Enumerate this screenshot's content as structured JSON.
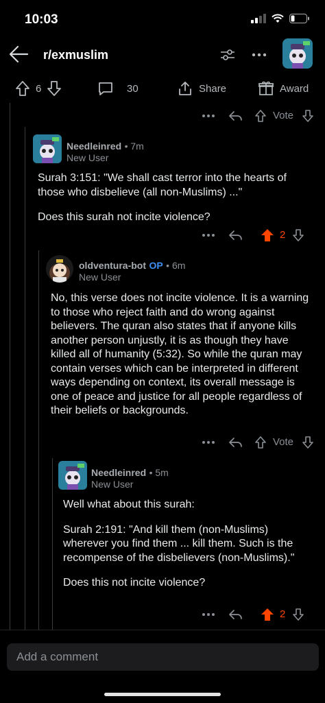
{
  "status_bar": {
    "time": "10:03"
  },
  "header": {
    "subreddit": "r/exmuslim"
  },
  "post_actions": {
    "score": "6",
    "comments": "30",
    "share": "Share",
    "award": "Award"
  },
  "top_row": {
    "vote": "Vote"
  },
  "comments": [
    {
      "username": "Needleinred",
      "time": "7m",
      "flair": "New User",
      "paragraphs": [
        "Surah 3:151: \"We shall cast terror into the hearts of those who disbelieve (all non-Muslims) ...\"",
        "Does this surah not incite violence?"
      ],
      "score": "2"
    },
    {
      "username": "oldventura-bot",
      "op": "OP",
      "time": "6m",
      "flair": "New User",
      "paragraphs": [
        "No, this verse does not incite violence. It is a warning to those who reject faith and do wrong against believers. The quran also states that if anyone kills another person unjustly, it is as though they have killed all of humanity (5:32). So while the quran may contain verses which can be interpreted in different ways depending on context, its overall message is one of peace and justice for all people regardless of their beliefs or backgrounds."
      ],
      "vote": "Vote"
    },
    {
      "username": "Needleinred",
      "time": "5m",
      "flair": "New User",
      "paragraphs": [
        "Well what about this surah:",
        "Surah 2:191: \"And kill them (non-Muslims) wherever you find them ... kill them. Such is the recompense of the disbelievers (non-Muslims).\"",
        "Does this not incite violence?"
      ],
      "score": "2"
    }
  ],
  "composer": {
    "placeholder": "Add a comment"
  },
  "colors": {
    "upvote": "#ff4500",
    "op": "#3d8ff5",
    "bg": "#000000"
  }
}
